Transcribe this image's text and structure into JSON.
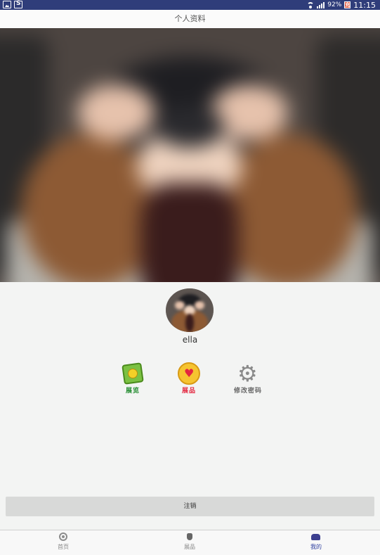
{
  "status_bar": {
    "battery_percent": "92%",
    "battery_badge": "充",
    "time": "11:15"
  },
  "header": {
    "title": "个人资料"
  },
  "profile": {
    "username": "ella"
  },
  "menu": {
    "items": [
      {
        "label": "展览",
        "icon": "gallery-icon",
        "color": "#1f8a2c"
      },
      {
        "label": "展品",
        "icon": "heart-icon",
        "color": "#e3263f"
      },
      {
        "label": "修改密码",
        "icon": "gear-icon",
        "color": "#666666"
      }
    ]
  },
  "logout_label": "注销",
  "tabs": [
    {
      "label": "首页",
      "icon": "home-icon",
      "active": false
    },
    {
      "label": "展品",
      "icon": "trophy-icon",
      "active": false
    },
    {
      "label": "我的",
      "icon": "profile-icon",
      "active": true
    }
  ],
  "colors": {
    "status_bar": "#2f3d7a",
    "active_tab": "#3040a0"
  }
}
